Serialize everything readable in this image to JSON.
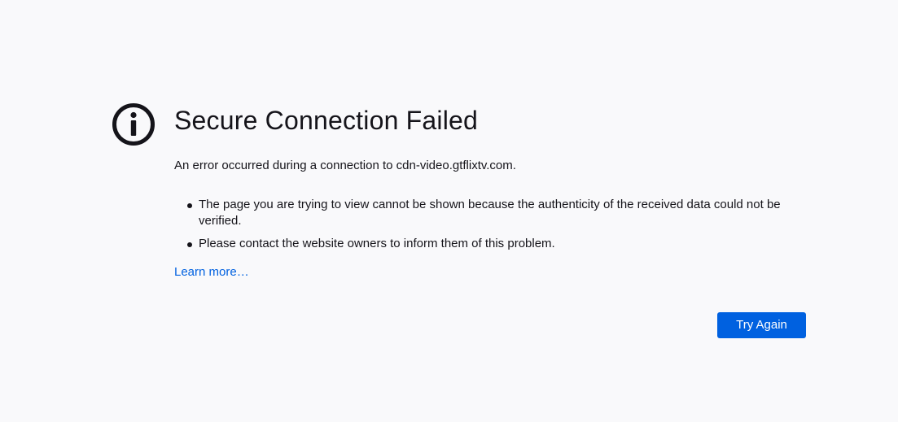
{
  "error_page": {
    "icon": "info-icon",
    "title": "Secure Connection Failed",
    "intro": "An error occurred during a connection to cdn-video.gtflixtv.com.",
    "bullets": [
      "The page you are trying to view cannot be shown because the authenticity of the received data could not be verified.",
      "Please contact the website owners to inform them of this problem."
    ],
    "learn_more": "Learn more…",
    "try_again": "Try Again"
  },
  "colors": {
    "background": "#f9f9fb",
    "text": "#15141a",
    "link": "#0061e0",
    "button": "#0061e0"
  }
}
